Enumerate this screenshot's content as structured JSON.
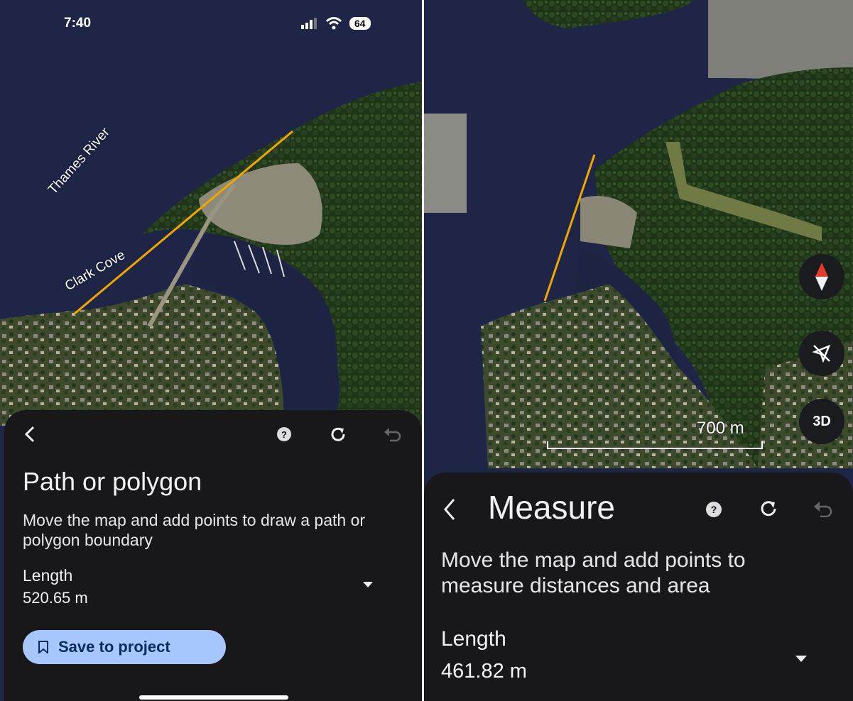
{
  "left_screen": {
    "status": {
      "time": "7:40",
      "battery": "64"
    },
    "map_labels": {
      "river": "Thames River",
      "cove": "Clark Cove"
    },
    "measure_color": "#f2a600",
    "toolbar": {
      "back_icon": "chevron-left-icon",
      "help_icon": "help-circle-icon",
      "reset_icon": "refresh-icon",
      "undo_icon": "undo-icon"
    },
    "title": "Path or polygon",
    "description": "Move the map and add points to draw a path or polygon boundary",
    "metric": {
      "label": "Length",
      "value": "520.65 m",
      "dropdown_icon": "dropdown-arrow-icon"
    },
    "save_label": "Save to project",
    "save_icon": "bookmark-icon",
    "save_button_color": "#a9c7ff"
  },
  "right_screen": {
    "measure_color": "#f2a600",
    "map_controls": {
      "compass_icon": "compass-icon",
      "location_icon": "location-off-icon",
      "view_3d": "3D"
    },
    "scale_label": "700 m",
    "toolbar": {
      "back_icon": "chevron-left-icon",
      "help_icon": "help-circle-icon",
      "reset_icon": "refresh-icon",
      "undo_icon": "undo-icon"
    },
    "title": "Measure",
    "description": "Move the map and add points to measure distances and area",
    "metric": {
      "label": "Length",
      "value": "461.82 m",
      "dropdown_icon": "dropdown-arrow-icon"
    }
  }
}
